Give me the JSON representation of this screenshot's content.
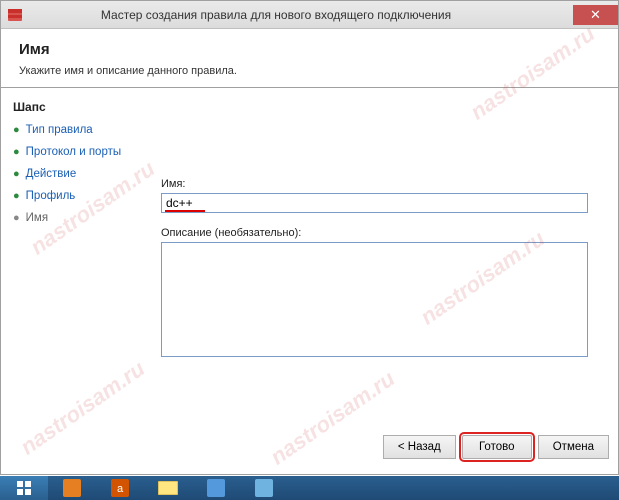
{
  "titlebar": {
    "title": "Мастер создания правила для нового входящего подключения"
  },
  "header": {
    "title": "Имя",
    "subtitle": "Укажите имя и описание данного правила."
  },
  "sidebar": {
    "heading": "Шапс",
    "items": [
      {
        "label": "Тип правила"
      },
      {
        "label": "Протокол и порты"
      },
      {
        "label": "Действие"
      },
      {
        "label": "Профиль"
      },
      {
        "label": "Имя"
      }
    ]
  },
  "form": {
    "name_label": "Имя:",
    "name_value": "dc++",
    "desc_label": "Описание (необязательно):",
    "desc_value": ""
  },
  "footer": {
    "back": "< Назад",
    "finish": "Готово",
    "cancel": "Отмена"
  },
  "watermark": "nastroisam.ru"
}
